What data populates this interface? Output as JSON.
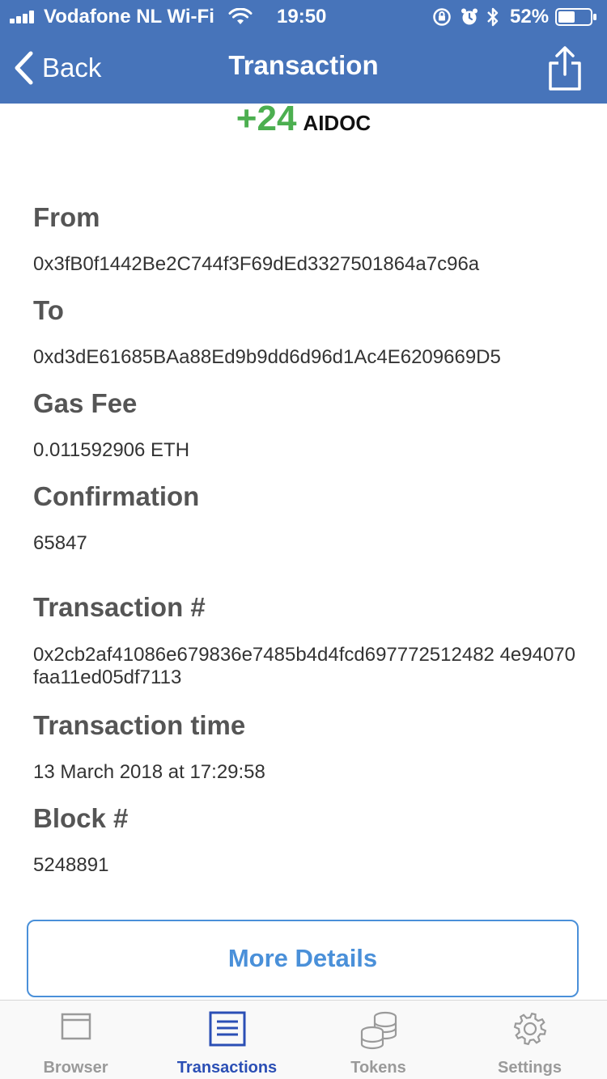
{
  "status_bar": {
    "carrier": "Vodafone NL Wi-Fi",
    "time": "19:50",
    "battery_percent": "52%",
    "battery_level": 0.52
  },
  "nav": {
    "back_label": "Back",
    "title": "Transaction"
  },
  "amount": {
    "value": "+24",
    "unit": "AIDOC",
    "color": "#4CAF50"
  },
  "fields": [
    {
      "label": "From",
      "value": "0x3fB0f1442Be2C744f3F69dEd3327501864a7c96a"
    },
    {
      "label": "To",
      "value": "0xd3dE61685BAa88Ed9b9dd6d96d1Ac4E6209669D5"
    },
    {
      "label": "Gas Fee",
      "value": "0.011592906 ETH"
    },
    {
      "label": "Confirmation",
      "value": "65847"
    },
    {
      "label": "Transaction #",
      "value": "0x2cb2af41086e679836e7485b4d4fcd697772512482 4e94070faa11ed05df7113"
    },
    {
      "label": "Transaction time",
      "value": "13 March 2018 at 17:29:58"
    },
    {
      "label": "Block #",
      "value": "5248891"
    }
  ],
  "actions": {
    "more_details_label": "More Details"
  },
  "tabs": [
    {
      "label": "Browser",
      "icon": "browser-window-icon",
      "active": false
    },
    {
      "label": "Transactions",
      "icon": "transactions-list-icon",
      "active": true
    },
    {
      "label": "Tokens",
      "icon": "tokens-coins-icon",
      "active": false
    },
    {
      "label": "Settings",
      "icon": "settings-gear-icon",
      "active": false
    }
  ],
  "colors": {
    "header": "#4774BA",
    "accent": "#4A90D9",
    "active_tab": "#2B4FB5",
    "inactive_tab": "#9a9a9a"
  }
}
